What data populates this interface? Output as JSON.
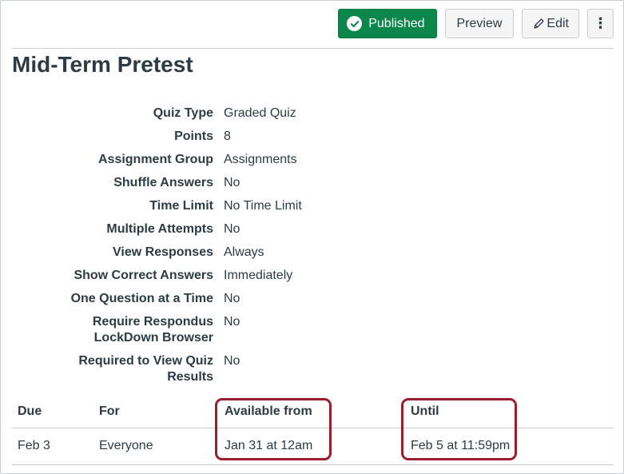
{
  "toolbar": {
    "published_label": "Published",
    "preview_label": "Preview",
    "edit_label": "Edit",
    "more_label": "⋮"
  },
  "quiz": {
    "title": "Mid-Term Pretest",
    "details": [
      {
        "label": "Quiz Type",
        "value": "Graded Quiz"
      },
      {
        "label": "Points",
        "value": "8"
      },
      {
        "label": "Assignment Group",
        "value": "Assignments"
      },
      {
        "label": "Shuffle Answers",
        "value": "No"
      },
      {
        "label": "Time Limit",
        "value": "No Time Limit"
      },
      {
        "label": "Multiple Attempts",
        "value": "No"
      },
      {
        "label": "View Responses",
        "value": "Always"
      },
      {
        "label": "Show Correct Answers",
        "value": "Immediately"
      },
      {
        "label": "One Question at a Time",
        "value": "No"
      },
      {
        "label": "Require Respondus LockDown Browser",
        "value": "No"
      },
      {
        "label": "Required to View Quiz Results",
        "value": "No"
      }
    ]
  },
  "dates": {
    "headers": [
      "Due",
      "For",
      "Available from",
      "Until"
    ],
    "row": [
      "Feb 3",
      "Everyone",
      "Jan 31 at 12am",
      "Feb 5 at 11:59pm"
    ]
  },
  "colors": {
    "published_green": "#0b874b",
    "highlight": "#9b1c2c",
    "text": "#2d3b45"
  }
}
